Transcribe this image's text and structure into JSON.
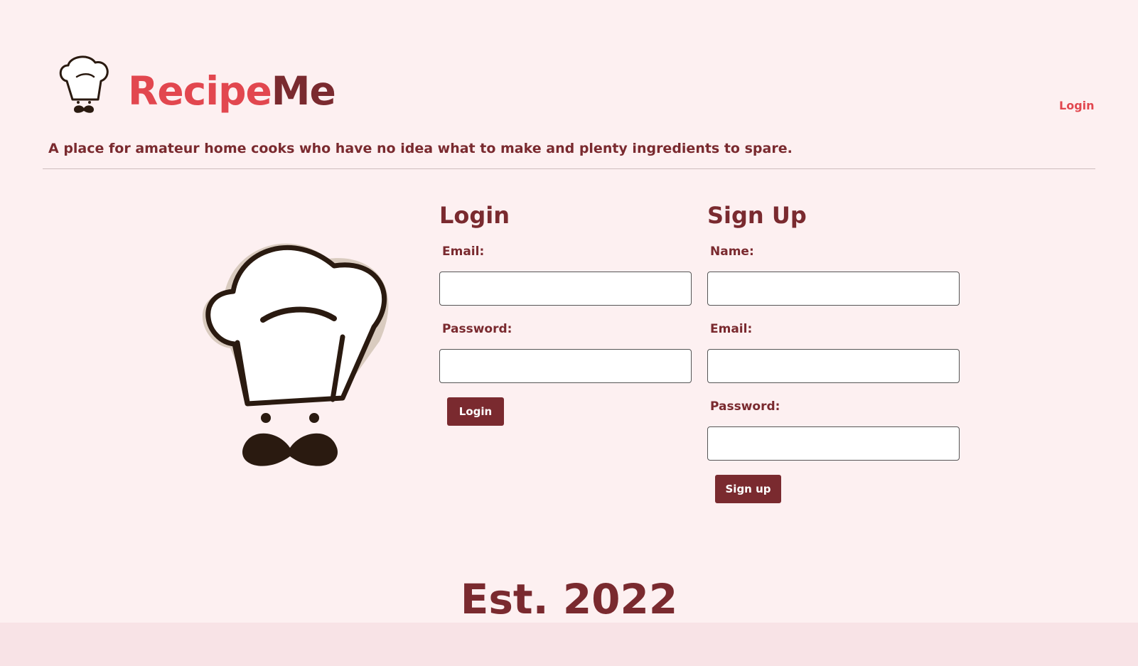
{
  "brand": {
    "part1": "Recipe",
    "part2": "Me",
    "tagline": "A place for amateur home cooks who have no idea what to make and plenty ingredients to spare.",
    "logo_icon": "chef-hat-mustache-icon"
  },
  "nav": {
    "login_label": "Login"
  },
  "login_form": {
    "title": "Login",
    "email_label": "Email:",
    "email_value": "",
    "password_label": "Password:",
    "password_value": "",
    "submit_label": "Login"
  },
  "signup_form": {
    "title": "Sign Up",
    "name_label": "Name:",
    "name_value": "",
    "email_label": "Email:",
    "email_value": "",
    "password_label": "Password:",
    "password_value": "",
    "submit_label": "Sign up"
  },
  "footer": {
    "established": "Est. 2022"
  },
  "colors": {
    "background": "#fdf0f1",
    "footer_band": "#f8e3e6",
    "brand_red": "#e2474f",
    "brand_maroon": "#7a2a2f",
    "button": "#7a2a2f"
  }
}
